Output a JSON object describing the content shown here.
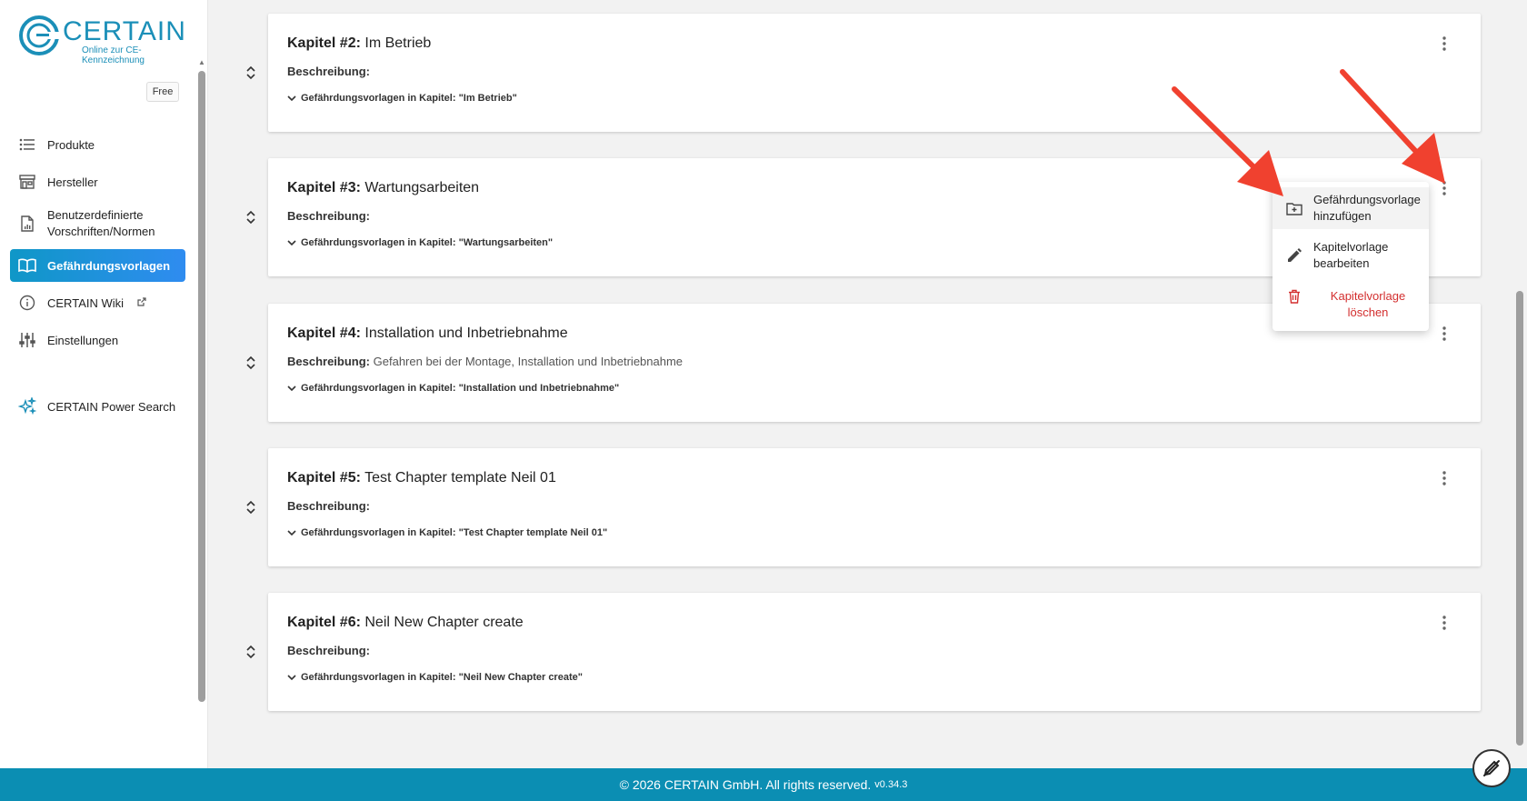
{
  "brand": {
    "name": "CERTAIN",
    "tagline": "Online zur CE-Kennzeichnung",
    "plan": "Free",
    "color": "#1b8fb8"
  },
  "sidebar": {
    "items": [
      {
        "label": "Produkte",
        "icon": "list-icon"
      },
      {
        "label": "Hersteller",
        "icon": "store-icon"
      },
      {
        "label": "Benutzerdefinierte Vorschriften/Normen",
        "icon": "document-chart-icon"
      },
      {
        "label": "Gefährdungsvorlagen",
        "icon": "book-icon",
        "active": true
      },
      {
        "label": "CERTAIN Wiki",
        "icon": "info-icon",
        "external": true
      },
      {
        "label": "Einstellungen",
        "icon": "sliders-icon"
      },
      {
        "label": "CERTAIN Power Search",
        "icon": "sparkle-icon"
      }
    ]
  },
  "chapters": [
    {
      "prefix": "Kapitel #2:",
      "name": "Im Betrieb",
      "desc_label": "Beschreibung:",
      "desc": "",
      "expand_label": "Gefährdungsvorlagen in Kapitel: \"Im Betrieb\""
    },
    {
      "prefix": "Kapitel #3:",
      "name": "Wartungsarbeiten",
      "desc_label": "Beschreibung:",
      "desc": "",
      "expand_label": "Gefährdungsvorlagen in Kapitel: \"Wartungsarbeiten\""
    },
    {
      "prefix": "Kapitel #4:",
      "name": "Installation und Inbetriebnahme",
      "desc_label": "Beschreibung:",
      "desc": "Gefahren bei der Montage, Installation und Inbetriebnahme",
      "expand_label": "Gefährdungsvorlagen in Kapitel: \"Installation und Inbetriebnahme\""
    },
    {
      "prefix": "Kapitel #5:",
      "name": "Test Chapter template Neil 01",
      "desc_label": "Beschreibung:",
      "desc": "",
      "expand_label": "Gefährdungsvorlagen in Kapitel: \"Test Chapter template Neil 01\""
    },
    {
      "prefix": "Kapitel #6:",
      "name": "Neil New Chapter create",
      "desc_label": "Beschreibung:",
      "desc": "",
      "expand_label": "Gefährdungsvorlagen in Kapitel: \"Neil New Chapter create\""
    }
  ],
  "context_menu": {
    "items": [
      {
        "label": "Gefährdungsvorlage hinzufügen",
        "icon": "folder-plus-icon"
      },
      {
        "label": "Kapitelvorlage bearbeiten",
        "icon": "pencil-icon"
      },
      {
        "label": "Kapitelvorlage löschen",
        "icon": "trash-icon",
        "danger": true
      }
    ]
  },
  "footer": {
    "text": "© 2026 CERTAIN GmbH. All rights reserved.",
    "version": "v0.34.3"
  },
  "colors": {
    "accent": "#0f97c7",
    "footer": "#0b8eb3",
    "danger": "#d32f2f",
    "annotation": "#f0412f"
  }
}
